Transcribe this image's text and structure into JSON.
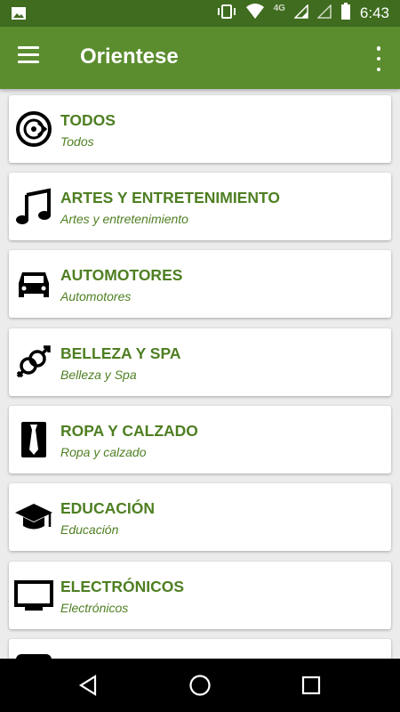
{
  "status": {
    "time": "6:43",
    "network": "4G"
  },
  "app": {
    "title": "Orientese"
  },
  "categories": [
    {
      "title": "TODOS",
      "subtitle": "Todos",
      "icon": "disc-icon"
    },
    {
      "title": "ARTES Y ENTRETENIMIENTO",
      "subtitle": "Artes y entretenimiento",
      "icon": "music-note-icon"
    },
    {
      "title": "AUTOMOTORES",
      "subtitle": "Automotores",
      "icon": "car-icon"
    },
    {
      "title": "BELLEZA Y SPA",
      "subtitle": "Belleza y Spa",
      "icon": "gender-icon"
    },
    {
      "title": "ROPA Y CALZADO",
      "subtitle": "Ropa y calzado",
      "icon": "tie-icon"
    },
    {
      "title": "EDUCACIÓN",
      "subtitle": "Educación",
      "icon": "graduation-cap-icon"
    },
    {
      "title": "ELECTRÓNICOS",
      "subtitle": "Electrónicos",
      "icon": "monitor-icon"
    }
  ],
  "colors": {
    "status_bar": "#3f6c1f",
    "app_bar": "#5b8d2f",
    "accent_text": "#4e7f22",
    "background": "#ececec"
  }
}
